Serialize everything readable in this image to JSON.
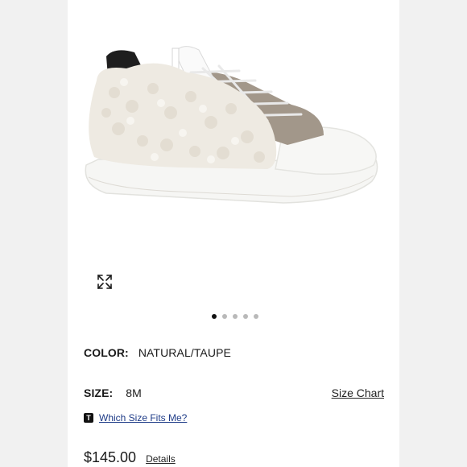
{
  "product": {
    "image_alt": "shoe-image",
    "gallery": {
      "total_slides": 5,
      "active_slide": 1
    },
    "color": {
      "label": "COLOR:",
      "value": "NATURAL/TAUPE"
    },
    "size": {
      "label": "SIZE:",
      "value": "8M",
      "chart_link": "Size Chart"
    },
    "fit": {
      "badge": "T",
      "link": "Which Size Fits Me?"
    },
    "price": {
      "value": "$145.00",
      "details_link": "Details"
    }
  },
  "icons": {
    "expand": "expand-icon",
    "fit_badge": "fit-predictor-icon"
  },
  "colors": {
    "background": "#f1f1f1",
    "panel": "#ffffff",
    "link_blue": "#1f3c88"
  }
}
